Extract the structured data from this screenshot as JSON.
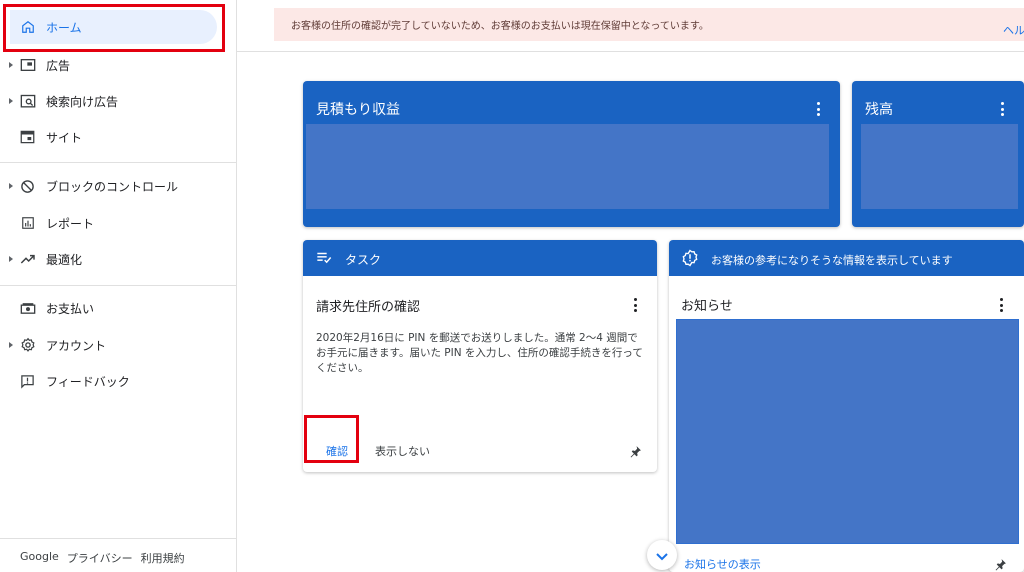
{
  "sidebar": {
    "items": [
      {
        "label": "ホーム",
        "icon": "home-icon"
      },
      {
        "label": "広告",
        "icon": "ad-unit-icon"
      },
      {
        "label": "検索向け広告",
        "icon": "search-ads-icon"
      },
      {
        "label": "サイト",
        "icon": "site-icon"
      },
      {
        "label": "ブロックのコントロール",
        "icon": "block-icon"
      },
      {
        "label": "レポート",
        "icon": "report-icon"
      },
      {
        "label": "最適化",
        "icon": "trending-up-icon"
      },
      {
        "label": "お支払い",
        "icon": "payment-icon"
      },
      {
        "label": "アカウント",
        "icon": "gear-icon"
      },
      {
        "label": "フィードバック",
        "icon": "feedback-icon"
      }
    ],
    "footer": {
      "google": "Google",
      "privacy": "プライバシー",
      "terms": "利用規約"
    }
  },
  "notice": {
    "text": "お客様の住所の確認が完了していないため、お客様のお支払いは現在保留中となっています。",
    "help": "ヘル"
  },
  "cards": {
    "estimated_earnings": {
      "title": "見積もり収益"
    },
    "balance": {
      "title": "残高"
    },
    "tasks": {
      "header": "タスク",
      "title": "請求先住所の確認",
      "body": "2020年2月16日に PIN を郵送でお送りしました。通常 2～4 週間でお手元に届きます。届いた PIN を入力し、住所の確認手続きを行ってください。",
      "confirm": "確認",
      "dismiss": "表示しない"
    },
    "info": {
      "header": "お客様の参考になりそうな情報を表示しています",
      "title": "お知らせ",
      "link": "お知らせの表示"
    }
  },
  "colors": {
    "accent": "#1a73e8",
    "card_blue": "#1a63c2",
    "placeholder": "#4475c7",
    "highlight": "#e3000f",
    "notice_bg": "#fce8e6"
  }
}
